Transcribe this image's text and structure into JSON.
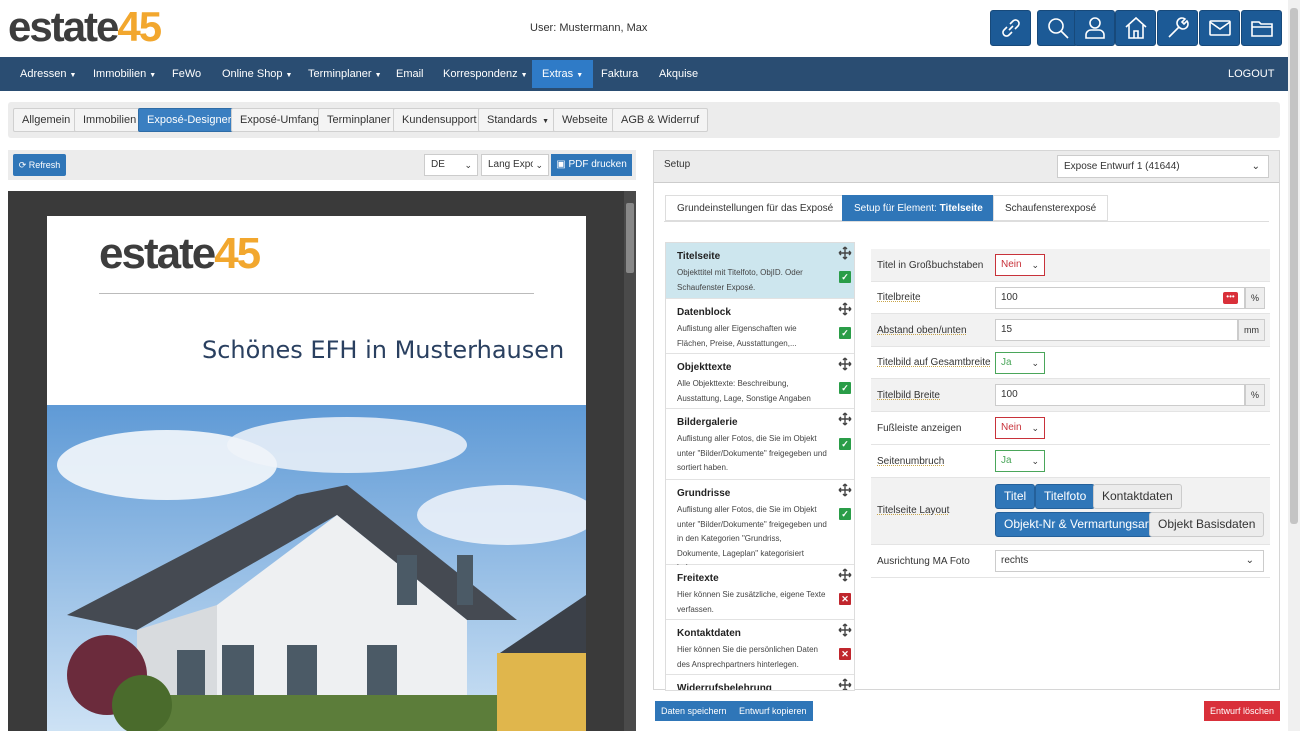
{
  "brand": {
    "logo_part1": "estate",
    "logo_part2": "45"
  },
  "user": {
    "label": "User: Mustermann, Max"
  },
  "toolbar_icons": [
    "link-icon",
    "search-icon",
    "user-icon",
    "home-icon",
    "wrench-icon",
    "mail-icon",
    "folder-icon"
  ],
  "nav": {
    "items": [
      "Adressen",
      "Immobilien",
      "FeWo",
      "Online Shop",
      "Terminplaner",
      "Email",
      "Korrespondenz",
      "Extras",
      "Faktura",
      "Akquise"
    ],
    "logout": "LOGOUT"
  },
  "subnav": {
    "items": [
      "Allgemein",
      "Immobilien",
      "Exposé-Designer",
      "Exposé-Umfang",
      "Terminplaner",
      "Kundensupport",
      "Standards",
      "Webseite",
      "AGB & Widerruf"
    ]
  },
  "preview_toolbar": {
    "refresh": "Refresh",
    "lang": "DE",
    "layout": "Lang Expo",
    "pdf": "PDF drucken"
  },
  "preview": {
    "title": "Schönes EFH in Musterhausen"
  },
  "setup": {
    "label": "Setup",
    "draft": "Expose Entwurf 1 (41644)",
    "tabs": [
      "Grundeinstellungen für das Exposé",
      "Setup für Element: ",
      "Schaufensterexposé"
    ],
    "tab_strong": "Titelseite"
  },
  "elements": [
    {
      "title": "Titelseite",
      "desc": "Objekttitel mit Titelfoto, ObjID. Oder Schaufenster Exposé.",
      "status": "on"
    },
    {
      "title": "Datenblock",
      "desc": "Auflistung aller Eigenschaften wie Flächen, Preise, Ausstattungen,...",
      "status": "on"
    },
    {
      "title": "Objekttexte",
      "desc": "Alle Objekttexte: Beschreibung, Ausstattung, Lage, Sonstige Angaben",
      "status": "on"
    },
    {
      "title": "Bildergalerie",
      "desc": "Auflistung aller Fotos, die Sie im Objekt unter \"Bilder/Dokumente\" freigegeben und sortiert haben.",
      "status": "on"
    },
    {
      "title": "Grundrisse",
      "desc": "Auflistung aller Fotos, die Sie im Objekt unter \"Bilder/Dokumente\" freigegeben und in den Kategorien \"Grundriss, Dokumente, Lageplan\" kategorisiert haben.",
      "status": "on"
    },
    {
      "title": "Freitexte",
      "desc": "Hier können Sie zusätzliche, eigene Texte verfassen.",
      "status": "off"
    },
    {
      "title": "Kontaktdaten",
      "desc": "Hier können Sie die persönlichen Daten des Ansprechpartners hinterlegen.",
      "status": "off"
    },
    {
      "title": "Widerrufsbelehrung",
      "desc": "",
      "status": ""
    }
  ],
  "fields": {
    "uppercase": {
      "label": "Titel in Großbuchstaben",
      "value": "Nein"
    },
    "width": {
      "label": "Titelbreite",
      "value": "100",
      "unit": "%"
    },
    "spacing": {
      "label": "Abstand oben/unten",
      "value": "15",
      "unit": "mm"
    },
    "fullwidth": {
      "label": "Titelbild auf Gesamtbreite",
      "value": "Ja"
    },
    "imgwidth": {
      "label": "Titelbild Breite",
      "value": "100",
      "unit": "%"
    },
    "footer": {
      "label": "Fußleiste anzeigen",
      "value": "Nein"
    },
    "pagebreak": {
      "label": "Seitenumbruch",
      "value": "Ja"
    },
    "layout": {
      "label": "Titelseite Layout",
      "options": [
        "Titel",
        "Titelfoto",
        "Kontaktdaten",
        "Objekt-Nr & Vermartungsart",
        "Objekt Basisdaten"
      ],
      "active": [
        "Titel",
        "Titelfoto",
        "Objekt-Nr & Vermartungsart"
      ]
    },
    "photo_align": {
      "label": "Ausrichtung MA Foto",
      "value": "rechts"
    }
  },
  "footer_buttons": {
    "save": "Daten speichern",
    "copy": "Entwurf kopieren",
    "delete": "Entwurf löschen"
  },
  "colors": {
    "nav": "#2a4d72",
    "primary": "#2f76b8",
    "brand_orange": "#f2a72e",
    "danger": "#d9303a",
    "success": "#2a9d48"
  }
}
